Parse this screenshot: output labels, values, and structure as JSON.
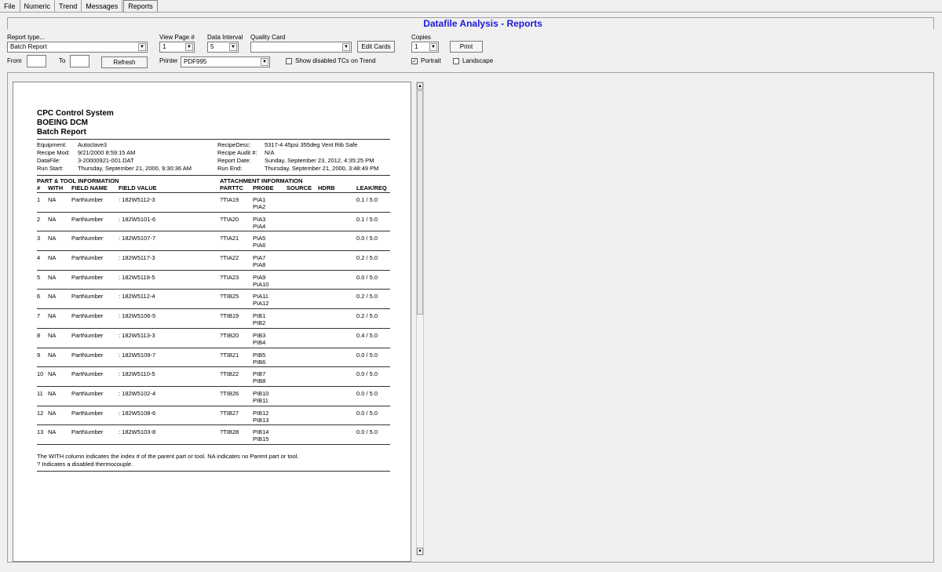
{
  "tabs": [
    "File",
    "Numeric",
    "Trend",
    "Messages",
    "Reports"
  ],
  "active_tab": "Reports",
  "title": "Datafile Analysis - Reports",
  "controls": {
    "report_type_label": "Report type...",
    "report_type_value": "Batch Report",
    "view_page_label": "View Page #",
    "view_page_value": "1",
    "data_interval_label": "Data Interval",
    "data_interval_value": "5",
    "quality_card_label": "Quality Card",
    "quality_card_value": "",
    "edit_cards_label": "Edit Cards",
    "copies_label": "Copies",
    "copies_value": "1",
    "print_label": "Print",
    "from_label": "From",
    "from_value": "",
    "to_label": "To",
    "to_value": "",
    "refresh_label": "Refresh",
    "printer_label": "Printer",
    "printer_value": "PDF995",
    "show_disabled_label": "Show disabled TCs on Trend",
    "show_disabled_checked": false,
    "portrait_label": "Portrait",
    "portrait_checked": true,
    "landscape_label": "Landscape",
    "landscape_checked": false
  },
  "report": {
    "line1": "CPC Control System",
    "line2": "BOEING DCM",
    "line3": "Batch Report",
    "meta_left": [
      {
        "k": "Equipment:",
        "v": "Autoclave3"
      },
      {
        "k": "Recipe Mod:",
        "v": "9/21/2000 8:59:15 AM"
      },
      {
        "k": "DataFile:",
        "v": "3-20000921-001.DAT"
      },
      {
        "k": "Run Start:",
        "v": "Thursday, September 21, 2000, 9:30:36 AM"
      }
    ],
    "meta_right": [
      {
        "k": "RecipeDesc:",
        "v": "5317-4 45psi 355deg Vent Rib Safe"
      },
      {
        "k": "Recipe Audit #:",
        "v": "N/A"
      },
      {
        "k": "Report Date:",
        "v": "Sunday, September 23, 2012, 4:35:25 PM"
      },
      {
        "k": "Run End:",
        "v": "Thursday, September 21, 2000, 3:48:49 PM"
      }
    ],
    "section_left": "PART & TOOL INFORMATION",
    "section_right": "ATTACHMENT INFORMATION",
    "headers": [
      "#",
      "WITH",
      "FIELD NAME",
      "FIELD VALUE",
      "PARTTC",
      "PROBE",
      "SOURCE",
      "HDRB",
      "LEAK/REQ"
    ],
    "rows": [
      {
        "n": "1",
        "with": "NA",
        "field": "PartNumber",
        "value": ": 182W5112-3",
        "parttc": "?TIA19",
        "probe1": "PIA1",
        "probe2": "PIA2",
        "leak": "0.1 / 5.0"
      },
      {
        "n": "2",
        "with": "NA",
        "field": "PartNumber",
        "value": ": 182W5101-6",
        "parttc": "?TIA20",
        "probe1": "PIA3",
        "probe2": "PIA4",
        "leak": "0.1 / 5.0"
      },
      {
        "n": "3",
        "with": "NA",
        "field": "PartNumber",
        "value": ": 182W5107-7",
        "parttc": "?TIA21",
        "probe1": "PIA5",
        "probe2": "PIA6",
        "leak": "0.0 / 5.0"
      },
      {
        "n": "4",
        "with": "NA",
        "field": "PartNumber",
        "value": ": 182W5117-3",
        "parttc": "?TIA22",
        "probe1": "PIA7",
        "probe2": "PIA8",
        "leak": "0.2 / 5.0"
      },
      {
        "n": "5",
        "with": "NA",
        "field": "PartNumber",
        "value": ": 182W5118-5",
        "parttc": "?TIA23",
        "probe1": "PIA9",
        "probe2": "PIA10",
        "leak": "0.0 / 5.0"
      },
      {
        "n": "6",
        "with": "NA",
        "field": "PartNumber",
        "value": ": 182W5112-4",
        "parttc": "?TIB25",
        "probe1": "PIA11",
        "probe2": "PIA12",
        "leak": "0.2 / 5.0"
      },
      {
        "n": "7",
        "with": "NA",
        "field": "PartNumber",
        "value": ": 182W5106-5",
        "parttc": "?TIB19",
        "probe1": "PIB1",
        "probe2": "PIB2",
        "leak": "0.2 / 5.0"
      },
      {
        "n": "8",
        "with": "NA",
        "field": "PartNumber",
        "value": ": 182W5113-3",
        "parttc": "?TIB20",
        "probe1": "PIB3",
        "probe2": "PIB4",
        "leak": "0.4 / 5.0"
      },
      {
        "n": "9",
        "with": "NA",
        "field": "PartNumber",
        "value": ": 182W5109-7",
        "parttc": "?TIB21",
        "probe1": "PIB5",
        "probe2": "PIB6",
        "leak": "0.0 / 5.0"
      },
      {
        "n": "10",
        "with": "NA",
        "field": "PartNumber",
        "value": ": 182W5110-5",
        "parttc": "?TIB22",
        "probe1": "PIB7",
        "probe2": "PIB8",
        "leak": "0.0 / 5.0"
      },
      {
        "n": "11",
        "with": "NA",
        "field": "PartNumber",
        "value": ": 182W5102-4",
        "parttc": "?TIB26",
        "probe1": "PIB10",
        "probe2": "PIB11",
        "leak": "0.0 / 5.0"
      },
      {
        "n": "12",
        "with": "NA",
        "field": "PartNumber",
        "value": ": 182W5108-6",
        "parttc": "?TIB27",
        "probe1": "PIB12",
        "probe2": "PIB13",
        "leak": "0.0 / 5.0"
      },
      {
        "n": "13",
        "with": "NA",
        "field": "PartNumber",
        "value": ": 182W5103-8",
        "parttc": "?TIB28",
        "probe1": "PIB14",
        "probe2": "PIB15",
        "leak": "0.0 / 5.0"
      }
    ],
    "footnote1": "The WITH column indicates the index # of the parent part or tool.  NA indicates no Parent part or tool.",
    "footnote2": "? Indicates a disabled thermocouple."
  },
  "colors": {
    "title": "#1a1adc",
    "background": "#f0f0f0"
  },
  "icons": {
    "dropdown": "chevron-down-icon",
    "scroll_up": "scroll-up-icon",
    "scroll_down": "scroll-down-icon",
    "check": "check-icon"
  }
}
